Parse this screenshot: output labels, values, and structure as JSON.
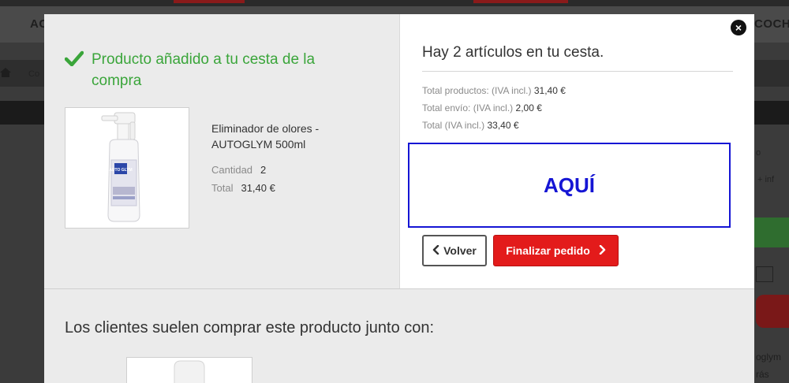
{
  "background": {
    "nav_left": "AC",
    "nav_right": "COCH",
    "crumb_text": "Co",
    "right_text_1": "o",
    "right_text_2": "+ inf",
    "right_text_3": "oglym",
    "right_text_4": "rás"
  },
  "modal": {
    "close_label": "×",
    "success_message": "Producto añadido a tu cesta de la compra",
    "product": {
      "name": "Eliminador de olores - AUTOGLYM 500ml",
      "quantity_label": "Cantidad",
      "quantity_value": "2",
      "total_label": "Total",
      "total_value": "31,40 €",
      "brand_label": "AUTO GLYM"
    },
    "cart": {
      "count_text": "Hay 2 artículos en tu cesta.",
      "products_label": "Total productos: (IVA incl.)",
      "products_value": "31,40 €",
      "shipping_label": "Total envío: (IVA incl.)",
      "shipping_value": "2,00 €",
      "total_label": "Total (IVA incl.)",
      "total_value": "33,40 €",
      "highlight_text": "AQUÍ",
      "back_label": "Volver",
      "checkout_label": "Finalizar pedido"
    },
    "also_bought_title": "Los clientes suelen comprar este producto junto con:"
  },
  "colors": {
    "success_green": "#3aa53a",
    "checkout_red": "#e31b1b",
    "highlight_blue": "#1515d4"
  }
}
